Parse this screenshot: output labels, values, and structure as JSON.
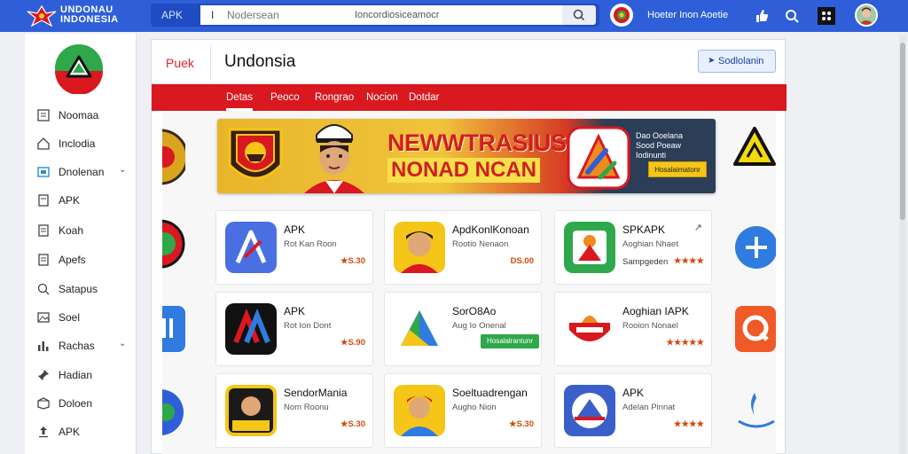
{
  "brand": {
    "line1": "UNDONAU",
    "line2": "INDONESIA"
  },
  "search": {
    "scope": "APK",
    "placeholder": "Nodersean",
    "hint": "Ioncordiosiceamocr"
  },
  "topbar": {
    "link": "Hoeter Inon Aoetie"
  },
  "sidebar": {
    "items": [
      {
        "label": "Noomaa",
        "icon": "list-icon"
      },
      {
        "label": "Inclodia",
        "icon": "home-icon"
      },
      {
        "label": "Dnolenan",
        "icon": "category-icon",
        "expandable": true
      },
      {
        "label": "APK",
        "icon": "doc-icon"
      },
      {
        "label": "Koah",
        "icon": "doc-icon"
      },
      {
        "label": "Apefs",
        "icon": "doc-icon"
      },
      {
        "label": "Satapus",
        "icon": "search-icon"
      },
      {
        "label": "Soel",
        "icon": "image-icon"
      },
      {
        "label": "Rachas",
        "icon": "chart-icon",
        "expandable": true
      },
      {
        "label": "Hadian",
        "icon": "pin-icon"
      },
      {
        "label": "Doloen",
        "icon": "box-icon"
      },
      {
        "label": "APK",
        "icon": "upload-icon"
      }
    ]
  },
  "main": {
    "tag": "Puek",
    "title": "Undonsia",
    "header_button": "Sodlolanin",
    "tabs": [
      "Detas",
      "Peoco",
      "Rongrao",
      "Nocion",
      "Dotdar"
    ]
  },
  "banner": {
    "title": "NEWWTRASIUS",
    "subtitle": "NONAD NCAN",
    "side_text": [
      "Dao Ooelana",
      "Sood Poeaw",
      "Iodinunti"
    ],
    "cta": "Hosalaimatonr"
  },
  "apps": [
    {
      "name": "APK",
      "sub": "Rot Kan Roon",
      "meta": "★S.30",
      "accent": "#4a6fe0"
    },
    {
      "name": "ApdKonlKonoan",
      "sub": "Rootio Nenaon",
      "meta": "DS.00",
      "accent": "#f5c518"
    },
    {
      "name": "SPKAPK",
      "sub": "Aoghian Nhaet",
      "meta": "★★★★",
      "meta2": "Sampgeden",
      "link": "↗",
      "accent": "#2ea84a"
    },
    {
      "name": "APK",
      "sub": "Rot Ion Dont",
      "meta": "★S.90",
      "accent": "#111111"
    },
    {
      "name": "SorO8Ao",
      "sub": "Aug Io Onenal",
      "button": "Hosalalrantunr",
      "accent": "#4a8be0"
    },
    {
      "name": "Aoghian IAPK",
      "sub": "Rooion Nonael",
      "meta": "★★★★★",
      "accent": "#d91820"
    },
    {
      "name": "SendorMania",
      "sub": "Nom Roonu",
      "meta": "★S.30",
      "accent": "#f5c518"
    },
    {
      "name": "Soeltuadrengan",
      "sub": "Augho Nion",
      "meta": "★S.30",
      "accent": "#f5c518"
    },
    {
      "name": "APK",
      "sub": "Adelan Pinnat",
      "meta": "★★★★",
      "accent": "#3a5fc8"
    }
  ]
}
